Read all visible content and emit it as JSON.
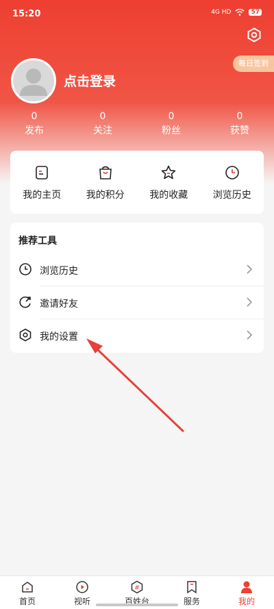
{
  "status": {
    "time": "15:20",
    "network": "4G HD",
    "battery": "57"
  },
  "header": {
    "checkin": "每日签到",
    "login": "点击登录"
  },
  "stats": [
    {
      "num": "0",
      "label": "发布"
    },
    {
      "num": "0",
      "label": "关注"
    },
    {
      "num": "0",
      "label": "粉丝"
    },
    {
      "num": "0",
      "label": "获赞"
    }
  ],
  "quick": [
    {
      "label": "我的主页",
      "icon": "homepage-icon"
    },
    {
      "label": "我的积分",
      "icon": "points-bag-icon"
    },
    {
      "label": "我的收藏",
      "icon": "star-icon"
    },
    {
      "label": "浏览历史",
      "icon": "clock-icon"
    }
  ],
  "tools": {
    "title": "推荐工具",
    "items": [
      {
        "label": "浏览历史",
        "icon": "clock-icon"
      },
      {
        "label": "邀请好友",
        "icon": "invite-icon"
      },
      {
        "label": "我的设置",
        "icon": "settings-hexagon-icon"
      }
    ]
  },
  "tabs": [
    {
      "label": "首页",
      "icon": "home-icon"
    },
    {
      "label": "视听",
      "icon": "play-icon"
    },
    {
      "label": "百姓台",
      "icon": "hashtag-icon"
    },
    {
      "label": "服务",
      "icon": "bookmark-icon"
    },
    {
      "label": "我的",
      "icon": "person-icon",
      "active": true
    }
  ],
  "colors": {
    "brand": "#ee3f31",
    "checkin_bg": "#f7c6a0",
    "annotation": "#e8403a"
  }
}
